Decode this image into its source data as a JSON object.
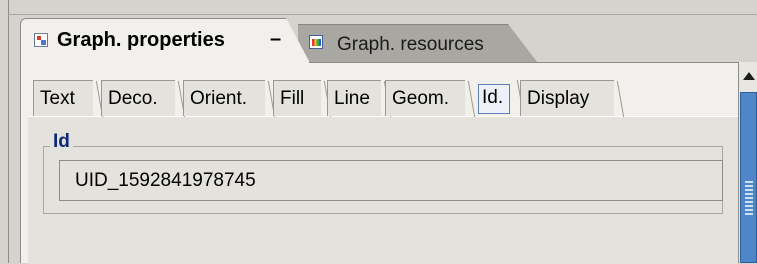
{
  "view_tabs": {
    "active_label": "Graph. properties",
    "close_label": "–",
    "inactive_label": "Graph. resources",
    "active_icon": "properties-icon",
    "inactive_icon": "resources-icon"
  },
  "sub_tabs": [
    "Text",
    "Deco.",
    "Orient.",
    "Fill",
    "Line",
    "Geom.",
    "Id.",
    "Display"
  ],
  "selected_sub_tab": "Id.",
  "group": {
    "title": "Id",
    "field_value": "UID_1592841978745"
  },
  "scrollbar": {
    "up_icon": "arrow-up-icon"
  },
  "colors": {
    "group_title": "#0c2a7a",
    "scroll_thumb": "#4f86c8"
  }
}
